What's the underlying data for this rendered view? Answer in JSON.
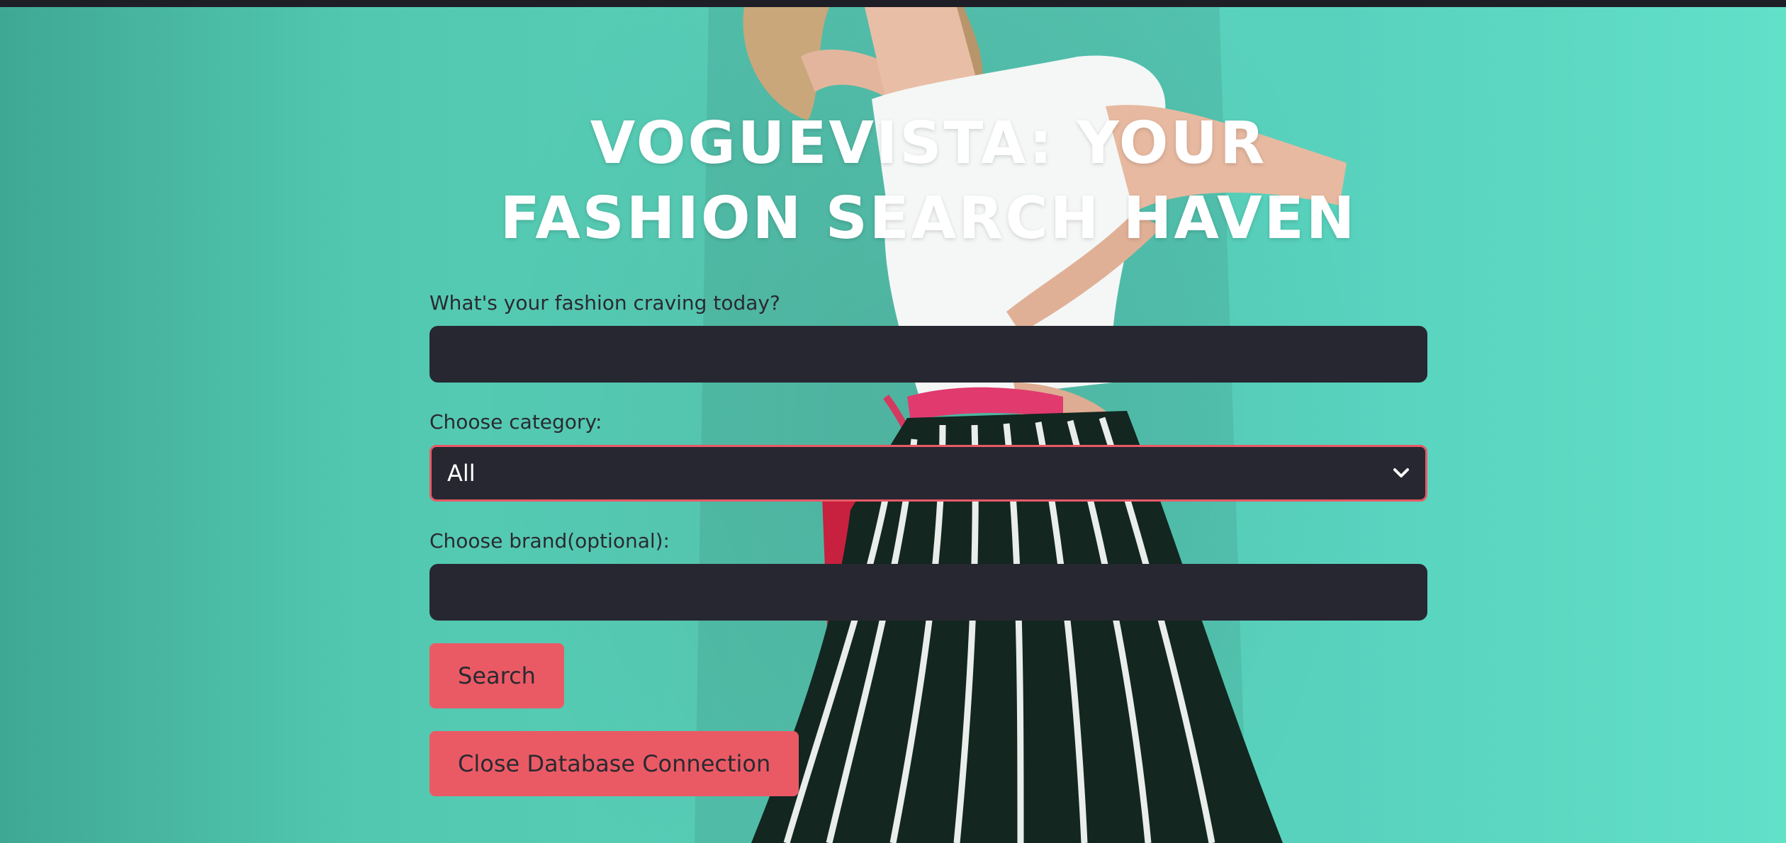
{
  "page": {
    "title": "VOGUEVISTA: YOUR FASHION SEARCH HAVEN"
  },
  "form": {
    "query_label": "What's your fashion craving today?",
    "query_value": "",
    "category_label": "Choose category:",
    "category_selected": "All",
    "brand_label": "Choose brand(optional):",
    "brand_value": ""
  },
  "buttons": {
    "search_label": "Search",
    "close_db_label": "Close Database Connection"
  },
  "icons": {
    "select_chevron": "chevron-down-icon"
  },
  "colors": {
    "accent": "#ea5a65",
    "field_bg": "#272731",
    "background": "#58d2bd",
    "title_text": "#ffffff"
  }
}
